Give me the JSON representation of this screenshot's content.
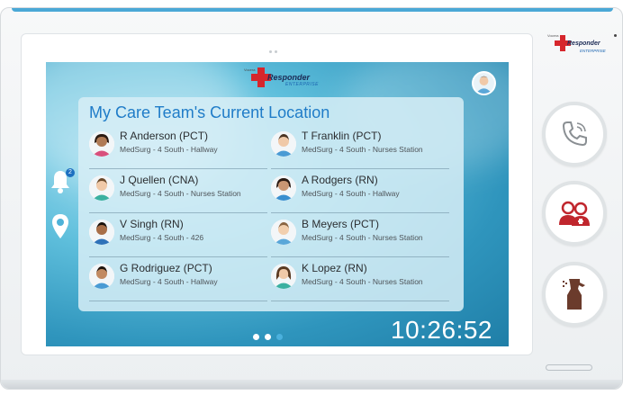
{
  "brand": {
    "small_text": "Vocera",
    "name": "Responder",
    "tagline": "ENTERPRISE",
    "red": "#d6262c",
    "navy": "#1b2a55"
  },
  "screen": {
    "title": "My Care Team's Current Location",
    "time": "10:26:52",
    "notification_count": "2",
    "pagination": {
      "total": 3,
      "active": 3
    },
    "team": [
      {
        "name": "R Anderson (PCT)",
        "location": "MedSurg - 4 South - Hallway",
        "avatar": "avatar-woman-dark"
      },
      {
        "name": "T Franklin (PCT)",
        "location": "MedSurg - 4 South - Nurses Station",
        "avatar": "avatar-man"
      },
      {
        "name": "J Quellen (CNA)",
        "location": "MedSurg - 4 South - Nurses Station",
        "avatar": "avatar-man"
      },
      {
        "name": "A Rodgers (RN)",
        "location": "MedSurg - 4 South - Hallway",
        "avatar": "avatar-woman-dark"
      },
      {
        "name": "V Singh (RN)",
        "location": "MedSurg - 4 South - 426",
        "avatar": "avatar-man-dark"
      },
      {
        "name": "B Meyers (PCT)",
        "location": "MedSurg - 4 South - Nurses Station",
        "avatar": "avatar-man"
      },
      {
        "name": "G Rodriguez (PCT)",
        "location": "MedSurg - 4 South - Hallway",
        "avatar": "avatar-man-dark"
      },
      {
        "name": "K Lopez (RN)",
        "location": "MedSurg - 4 South - Nurses Station",
        "avatar": "avatar-woman"
      }
    ]
  },
  "side_buttons": [
    {
      "icon": "phone-icon"
    },
    {
      "icon": "care-team-icon"
    },
    {
      "icon": "spray-bottle-icon"
    }
  ],
  "colors": {
    "accent": "#1f7cc8",
    "screen_bg": "#2f95bd",
    "active_dot": "#4bb1de"
  }
}
